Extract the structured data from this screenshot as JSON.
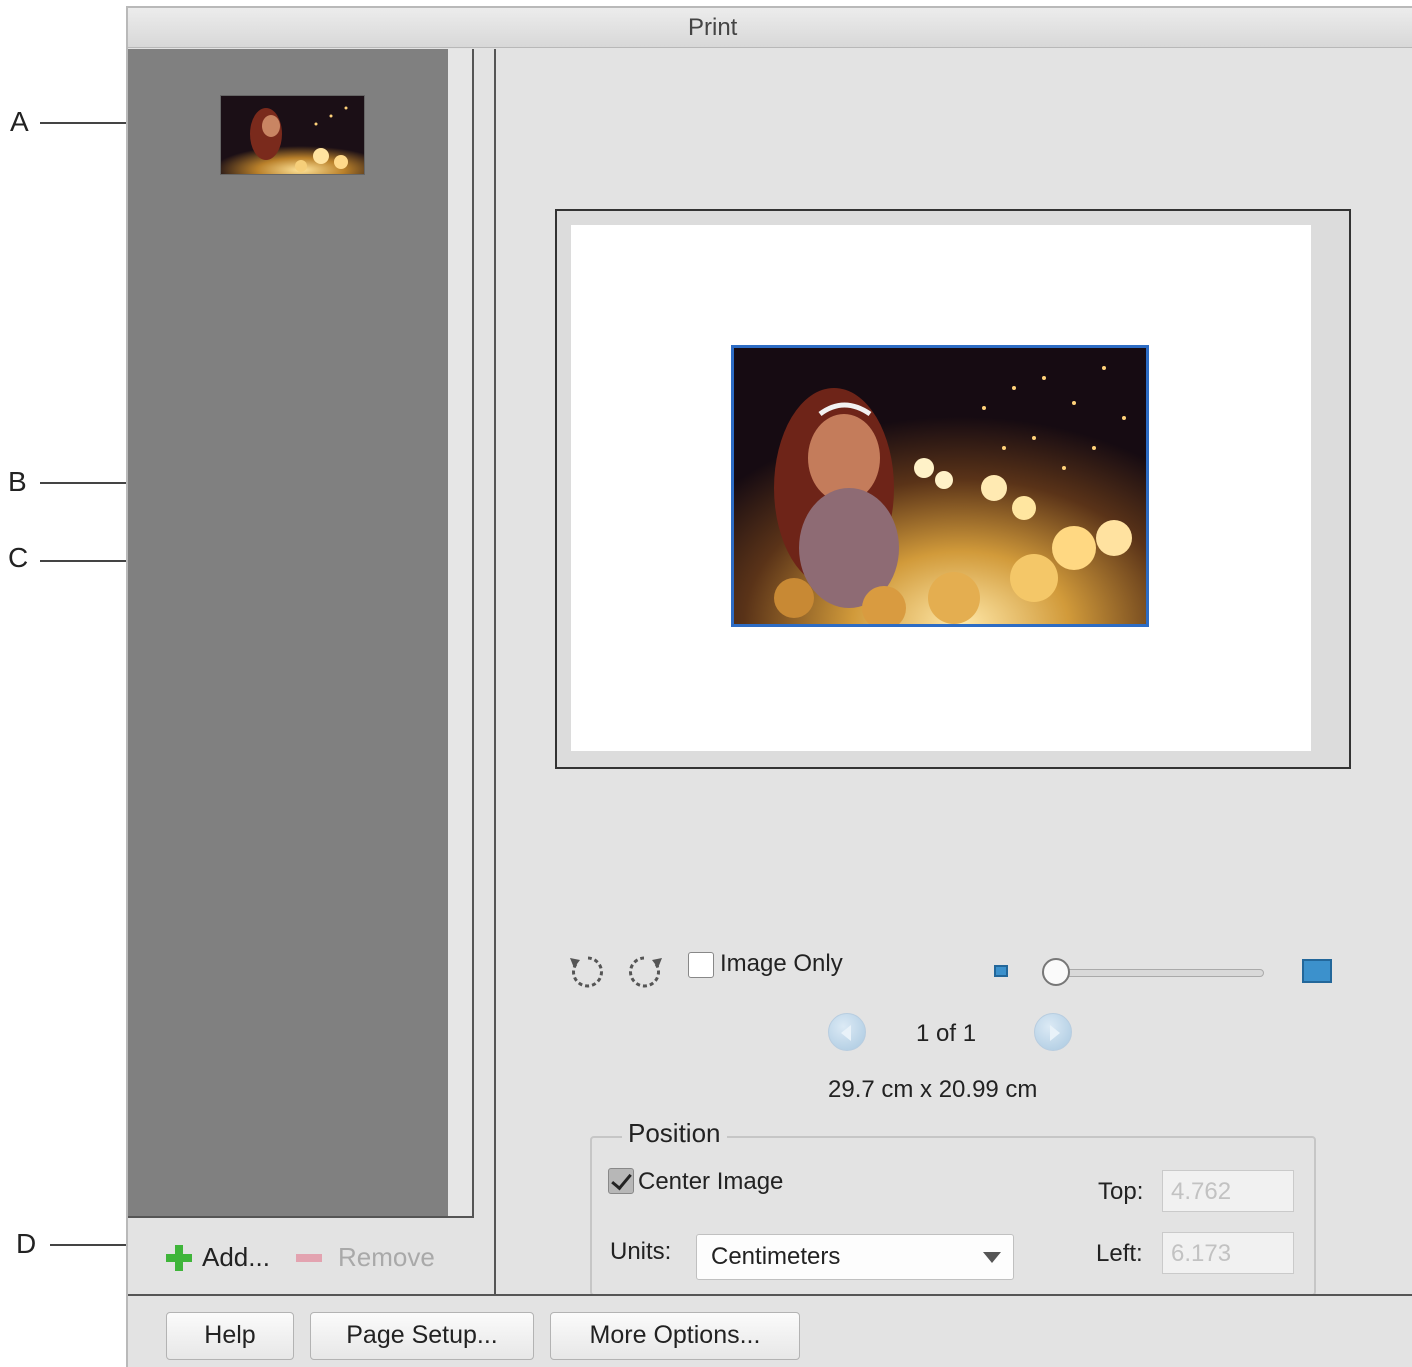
{
  "callouts": {
    "a": "A",
    "b": "B",
    "c": "C",
    "d": "D"
  },
  "window": {
    "title": "Print"
  },
  "tray": {
    "add_label": "Add...",
    "remove_label": "Remove"
  },
  "controls": {
    "rotate_left_icon": "rotate-left-icon",
    "rotate_right_icon": "rotate-right-icon",
    "image_only_label": "Image Only",
    "image_only_checked": false,
    "zoom_level": 0.0,
    "page_indicator": "1 of 1",
    "paper_size": "29.7 cm x 20.99 cm"
  },
  "position": {
    "title": "Position",
    "center_image_label": "Center Image",
    "center_image_checked": true,
    "units_label": "Units:",
    "units_value": "Centimeters",
    "top_label": "Top:",
    "top_value": "4.762",
    "left_label": "Left:",
    "left_value": "6.173"
  },
  "buttons": {
    "help": "Help",
    "page_setup": "Page Setup...",
    "more_options": "More Options..."
  },
  "colors": {
    "selection_border": "#2d6cc4",
    "add_icon": "#3fb53a",
    "remove_icon": "#e3a3b0",
    "tray_bg": "#808080"
  }
}
